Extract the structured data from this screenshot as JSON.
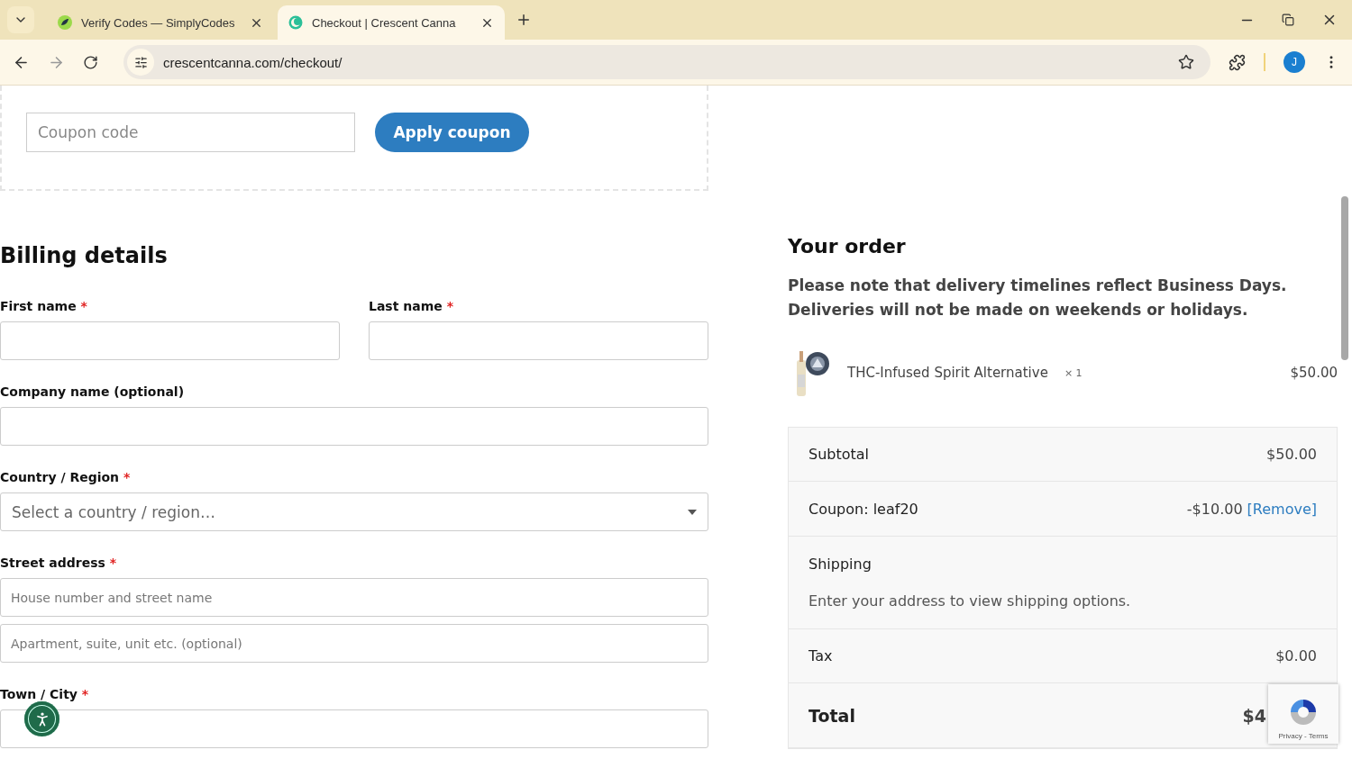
{
  "browser": {
    "tabs": [
      {
        "title": "Verify Codes — SimplyCodes",
        "kind": "leaf",
        "selected": false
      },
      {
        "title": "Checkout | Crescent Canna",
        "kind": "crescent",
        "selected": true
      }
    ],
    "address": "crescentcanna.com/checkout/",
    "profile_initial": "J"
  },
  "coupon": {
    "placeholder": "Coupon code",
    "button": "Apply coupon"
  },
  "billing": {
    "title": "Billing details",
    "fields": [
      {
        "label": "First name",
        "required_mark": "*",
        "kind": "text",
        "half": true
      },
      {
        "label": "Last name",
        "required_mark": "*",
        "kind": "text",
        "half": true
      },
      {
        "label": "Company name (optional)",
        "kind": "text",
        "half": false
      },
      {
        "label": "Country / Region",
        "required_mark": "*",
        "kind": "select",
        "half": false,
        "placeholders": [
          "Select a country / region…"
        ]
      },
      {
        "label": "Street address",
        "required_mark": "*",
        "kind": "text",
        "half": false,
        "placeholders": [
          "House number and street name",
          "Apartment, suite, unit etc. (optional)"
        ]
      },
      {
        "label": "Town / City",
        "required_mark": "*",
        "kind": "text",
        "half": false
      }
    ]
  },
  "order": {
    "title": "Your order",
    "notice": "Please note that delivery timelines reflect Business Days. Deliveries will not be made on weekends or holidays.",
    "items": [
      {
        "name": "THC-Infused Spirit Alternative",
        "quantity": "× 1",
        "price": "$50.00"
      }
    ],
    "rows": [
      {
        "kind": "amount",
        "label": "Subtotal",
        "value": "$50.00"
      },
      {
        "kind": "coupon",
        "label": "Coupon: leaf20",
        "value": "-$10.00",
        "link": "[Remove]"
      },
      {
        "kind": "shipping",
        "label": "Shipping",
        "note": "Enter your address to view shipping options."
      },
      {
        "kind": "amount",
        "label": "Tax",
        "value": "$0.00"
      },
      {
        "kind": "total",
        "label": "Total",
        "value": "$4"
      }
    ]
  },
  "recaptcha": {
    "links": "Privacy - Terms"
  }
}
